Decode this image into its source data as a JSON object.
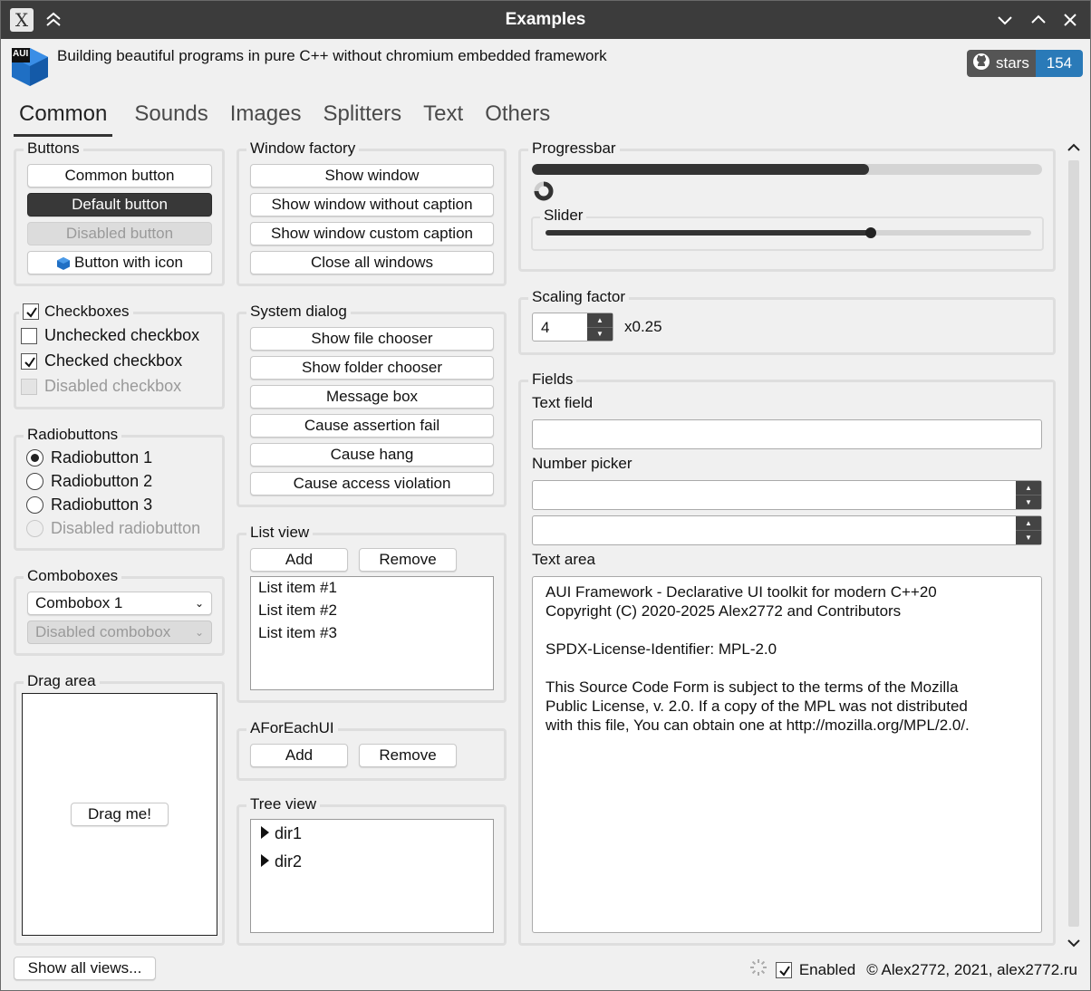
{
  "window": {
    "title": "Examples"
  },
  "header": {
    "logo_text": "AUI",
    "tagline": "Building beautiful programs in pure C++ without chromium embedded framework",
    "badge": {
      "label": "stars",
      "count": "154"
    }
  },
  "tabs": [
    {
      "label": "Common",
      "active": true
    },
    {
      "label": "Sounds"
    },
    {
      "label": "Images"
    },
    {
      "label": "Splitters"
    },
    {
      "label": "Text"
    },
    {
      "label": "Others"
    }
  ],
  "buttons": {
    "title": "Buttons",
    "common": "Common button",
    "default": "Default button",
    "disabled": "Disabled button",
    "with_icon": "Button with icon"
  },
  "checkboxes": {
    "title": "Checkboxes",
    "unchecked": "Unchecked checkbox",
    "checked": "Checked checkbox",
    "disabled": "Disabled checkbox"
  },
  "radiobuttons": {
    "title": "Radiobuttons",
    "items": [
      "Radiobutton 1",
      "Radiobutton 2",
      "Radiobutton 3",
      "Disabled radiobutton"
    ],
    "selected_index": 0
  },
  "comboboxes": {
    "title": "Comboboxes",
    "combo1": "Combobox 1",
    "disabled": "Disabled combobox"
  },
  "drag_area": {
    "title": "Drag area",
    "button": "Drag me!"
  },
  "window_factory": {
    "title": "Window factory",
    "buttons": [
      "Show window",
      "Show window without caption",
      "Show window custom caption",
      "Close all windows"
    ]
  },
  "system_dialog": {
    "title": "System dialog",
    "buttons": [
      "Show file chooser",
      "Show folder chooser",
      "Message box",
      "Cause assertion fail",
      "Cause hang",
      "Cause access violation"
    ]
  },
  "list_view": {
    "title": "List view",
    "add": "Add",
    "remove": "Remove",
    "items": [
      "List item #1",
      "List item #2",
      "List item #3"
    ]
  },
  "foreach_ui": {
    "title": "AForEachUI",
    "add": "Add",
    "remove": "Remove"
  },
  "tree_view": {
    "title": "Tree view",
    "items": [
      "dir1",
      "dir2"
    ]
  },
  "progressbar": {
    "title": "Progressbar",
    "value": 0.66
  },
  "slider": {
    "title": "Slider",
    "value": 0.67
  },
  "scaling": {
    "title": "Scaling factor",
    "value": "4",
    "suffix": "x0.25"
  },
  "fields": {
    "title": "Fields",
    "text_field_label": "Text field",
    "text_field_value": "",
    "number_picker_label": "Number picker",
    "text_area_label": "Text area",
    "text_area_content": "AUI Framework - Declarative UI toolkit for modern C++20\nCopyright (C) 2020-2025 Alex2772 and Contributors\n\nSPDX-License-Identifier: MPL-2.0\n\nThis Source Code Form is subject to the terms of the Mozilla\nPublic License, v. 2.0. If a copy of the MPL was not distributed\nwith this file, You can obtain one at http://mozilla.org/MPL/2.0/."
  },
  "footer": {
    "show_all_views": "Show all views...",
    "enabled_label": "Enabled",
    "copyright": "© Alex2772, 2021, alex2772.ru"
  }
}
